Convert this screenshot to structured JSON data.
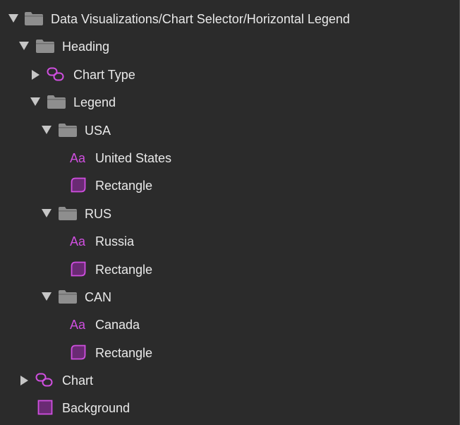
{
  "tree": {
    "root_label": "Data Visualizations/Chart Selector/Horizontal Legend",
    "heading_label": "Heading",
    "chart_type_label": "Chart Type",
    "legend_label": "Legend",
    "usa_label": "USA",
    "usa_text": "United States",
    "usa_rect": "Rectangle",
    "rus_label": "RUS",
    "rus_text": "Russia",
    "rus_rect": "Rectangle",
    "can_label": "CAN",
    "can_text": "Canada",
    "can_rect": "Rectangle",
    "chart_label": "Chart",
    "background_label": "Background",
    "text_icon_glyph": "Aa"
  },
  "colors": {
    "background": "#2b2b2b",
    "folder_icon": "#8e8e8e",
    "symbol_accent": "#d04fe0",
    "text": "#e9e9e9"
  }
}
